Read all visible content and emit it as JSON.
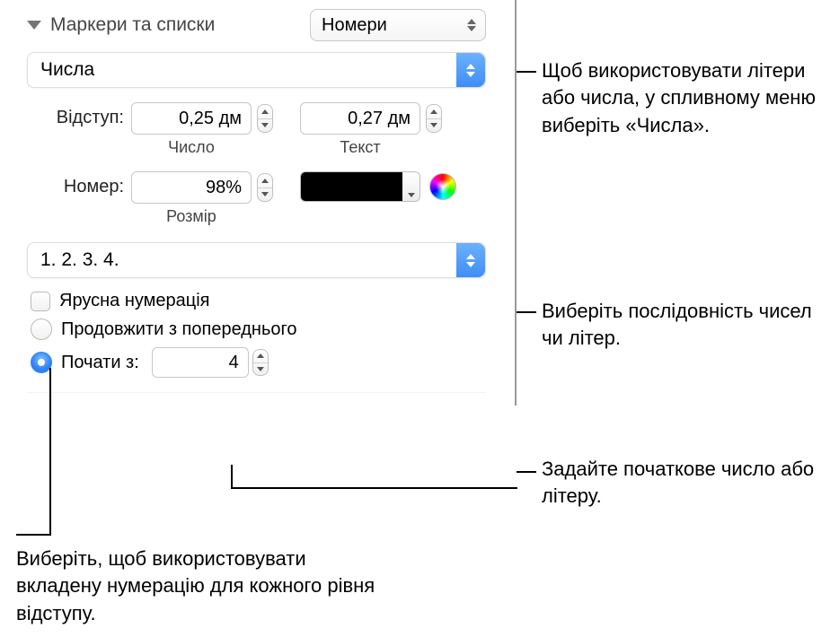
{
  "header": {
    "title": "Маркери та списки",
    "type_dropdown": "Номери"
  },
  "style_dropdown": "Числа",
  "indent": {
    "label": "Відступ:",
    "number_value": "0,25 дм",
    "number_sub": "Число",
    "text_value": "0,27 дм",
    "text_sub": "Текст"
  },
  "number": {
    "label": "Номер:",
    "size_value": "98%",
    "size_sub": "Розмір"
  },
  "sequence_dropdown": "1. 2. 3. 4.",
  "options": {
    "tiered": "Ярусна нумерація",
    "continue": "Продовжити з попереднього",
    "start_label": "Почати з:",
    "start_value": "4"
  },
  "callouts": {
    "c1": "Щоб використовувати літери або числа, у спливному меню виберіть «Числа».",
    "c2": "Виберіть послідовність чисел чи літер.",
    "c3": "Задайте початкове число або літеру.",
    "c4": "Виберіть, щоб використовувати вкладену нумерацію для кожного рівня відступу."
  }
}
